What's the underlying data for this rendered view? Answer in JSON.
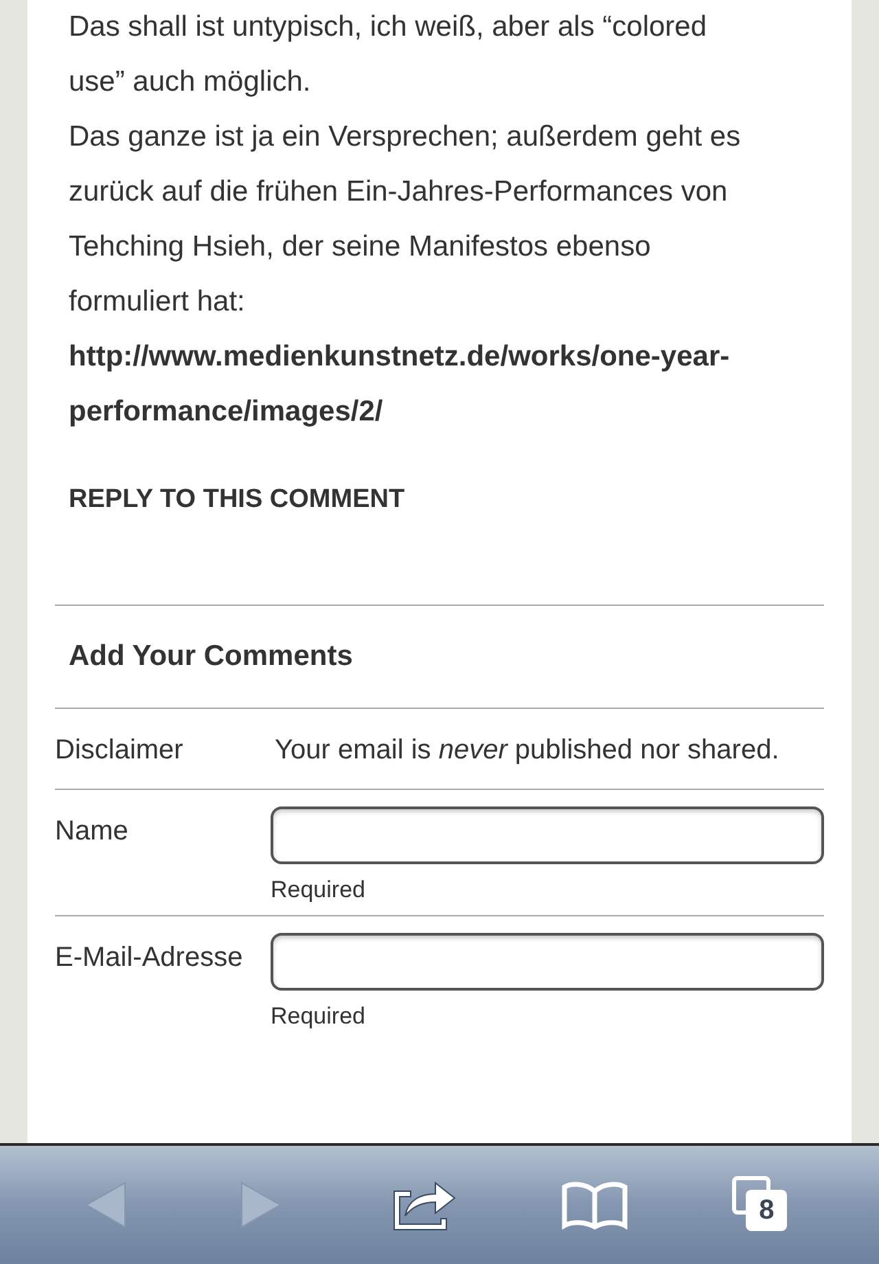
{
  "comment": {
    "paragraphs": [
      "Das shall ist untypisch, ich weiß, aber als “colored use” auch möglich.",
      "Das ganze ist ja ein Versprechen; außerdem geht es zurück auf die frühen Ein-Jahres-Performances von Tehching Hsieh, der seine Manifestos ebenso formuliert hat:"
    ],
    "link": "http://www.medienkunstnetz.de/works/one-year-performance/images/2/",
    "reply": "REPLY TO THIS COMMENT"
  },
  "form": {
    "title": "Add Your Comments",
    "rows": [
      {
        "kind": "text",
        "label": "Disclaimer",
        "value": "Your email is *never* published nor shared."
      },
      {
        "kind": "input",
        "label": "Name",
        "hint": "Required"
      },
      {
        "kind": "input",
        "label": "E-Mail-Adresse",
        "hint": "Required"
      }
    ]
  },
  "toolbar": {
    "back": {
      "disabled": true
    },
    "forward": {
      "disabled": true
    },
    "tab_count": "8"
  }
}
